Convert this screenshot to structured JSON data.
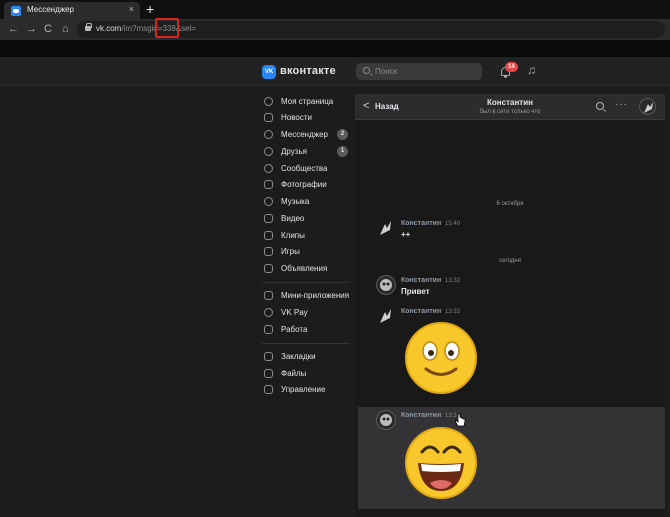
{
  "browser": {
    "tab_title": "Мессенджер",
    "tab_close": "×",
    "new_tab": "+",
    "nav": {
      "back": "←",
      "forward": "→",
      "reload": "C",
      "home": "⌂"
    },
    "url_main": "vk.com",
    "url_path_a": "/im?msgid",
    "url_path_b": "=338",
    "url_path_c": "&sel="
  },
  "vk": {
    "logo_glyph": "VK",
    "name": "вконтакте",
    "search_placeholder": "Поиск",
    "notifications_badge": "14",
    "music_glyph": "♫",
    "accent": "#2787f5"
  },
  "menu": {
    "items": [
      {
        "label": "Моя страница",
        "icon": "user-icon"
      },
      {
        "label": "Новости",
        "icon": "news-icon"
      },
      {
        "label": "Мессенджер",
        "icon": "message-icon",
        "count": "2"
      },
      {
        "label": "Друзья",
        "icon": "friends-icon",
        "count": "1"
      },
      {
        "label": "Сообщества",
        "icon": "communities-icon"
      },
      {
        "label": "Фотографии",
        "icon": "photos-icon"
      },
      {
        "label": "Музыка",
        "icon": "music-icon"
      },
      {
        "label": "Видео",
        "icon": "video-icon"
      },
      {
        "label": "Клипы",
        "icon": "clips-icon"
      },
      {
        "label": "Игры",
        "icon": "games-icon"
      },
      {
        "label": "Объявления",
        "icon": "ads-icon"
      }
    ],
    "items2": [
      {
        "label": "Мини-приложения",
        "icon": "apps-icon"
      },
      {
        "label": "VK Pay",
        "icon": "vkpay-icon"
      },
      {
        "label": "Работа",
        "icon": "work-icon"
      }
    ],
    "items3": [
      {
        "label": "Закладки",
        "icon": "bookmarks-icon"
      },
      {
        "label": "Файлы",
        "icon": "files-icon"
      },
      {
        "label": "Управление",
        "icon": "manage-icon"
      }
    ]
  },
  "chat": {
    "back_glyph": "<",
    "back_label": "Назад",
    "peer_name": "Константин",
    "peer_status": "был в сети только что",
    "more_glyph": "···",
    "date1": "6 октября",
    "date2": "сегодня",
    "messages": [
      {
        "author": "Константин",
        "time": "15:40",
        "text": "++"
      },
      {
        "author": "Константин",
        "time": "13:32",
        "text": "Привет"
      },
      {
        "author": "Константин",
        "time": "13:33",
        "sticker": "smile-sticker"
      },
      {
        "author": "Константин",
        "time": "13:3",
        "sticker": "laugh-sticker"
      }
    ]
  }
}
